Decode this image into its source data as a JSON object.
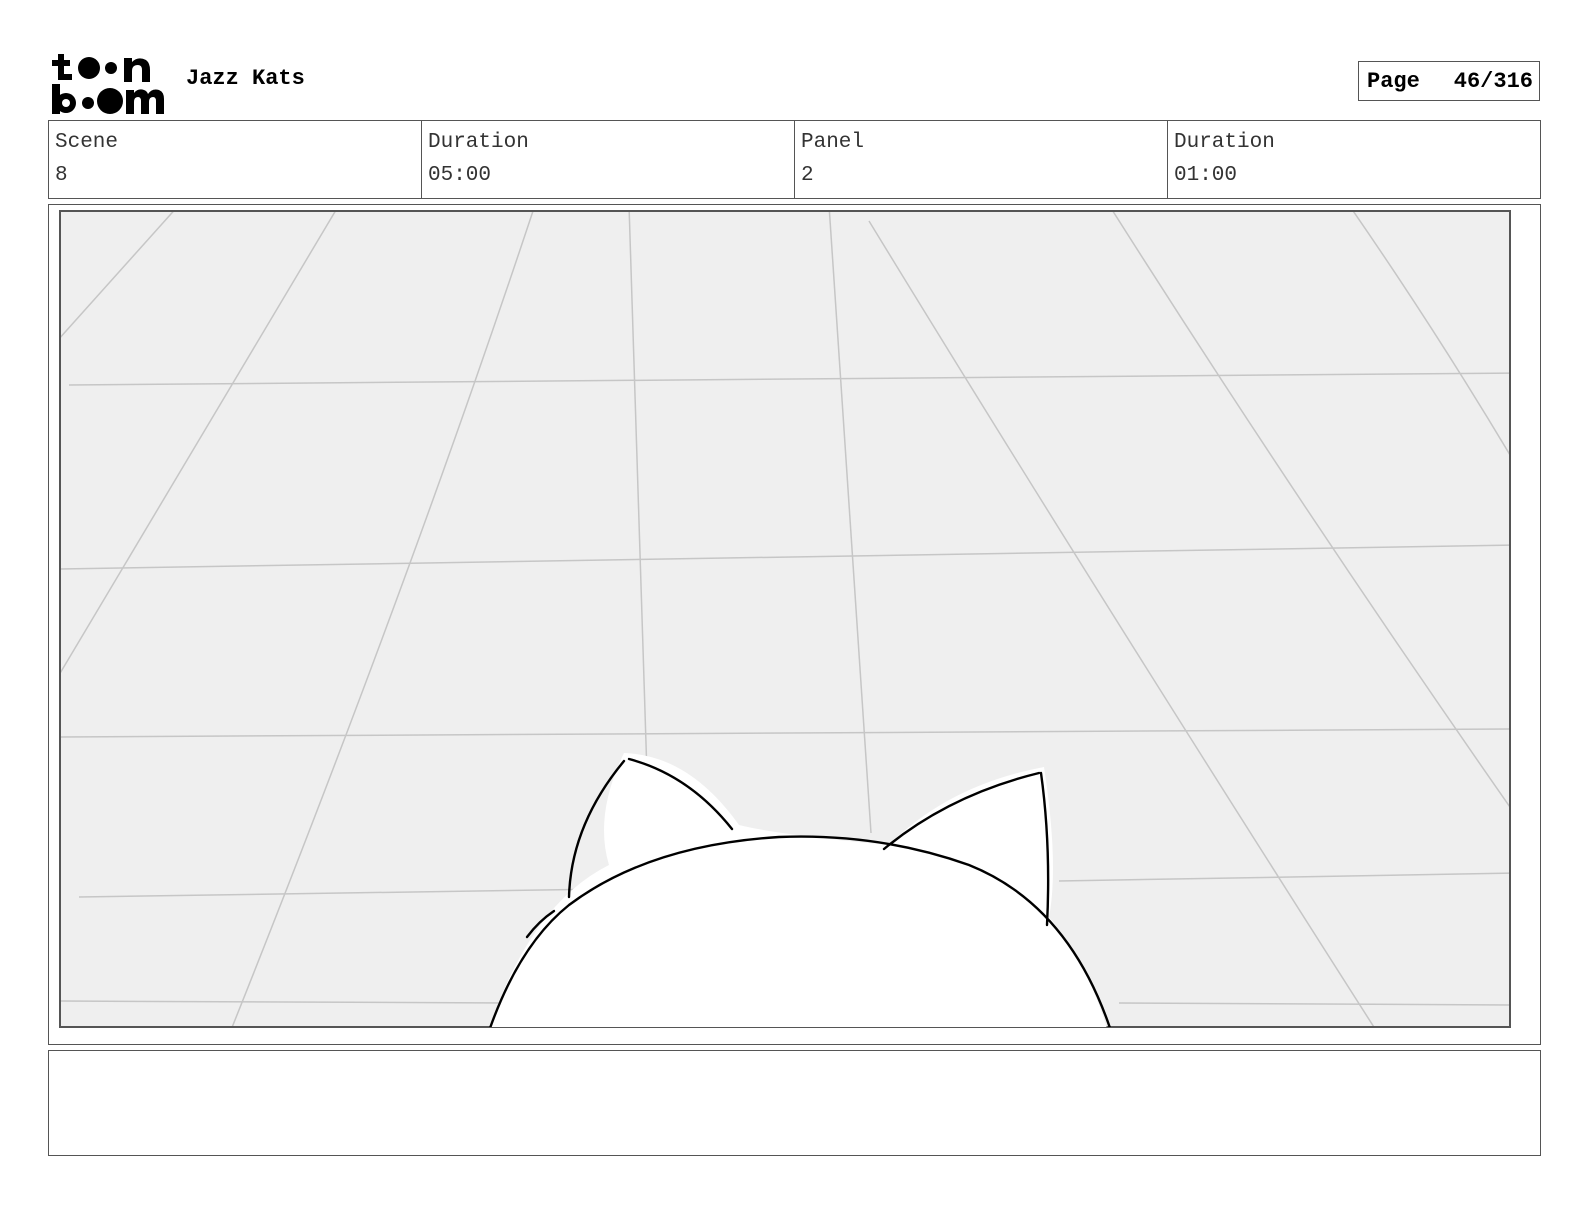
{
  "header": {
    "logo_text": "toon boom",
    "project_title": "Jazz Kats",
    "page_label": "Page",
    "page_value": "46/316"
  },
  "info": {
    "scene_label": "Scene",
    "scene_value": "8",
    "scene_duration_label": "Duration",
    "scene_duration_value": "05:00",
    "panel_label": "Panel",
    "panel_value": "2",
    "panel_duration_label": "Duration",
    "panel_duration_value": "01:00"
  },
  "notes": {
    "text": ""
  },
  "colors": {
    "floor": "#efefef",
    "grid_line": "#c8c8c8",
    "frame_border": "#555555",
    "ink": "#000000"
  }
}
